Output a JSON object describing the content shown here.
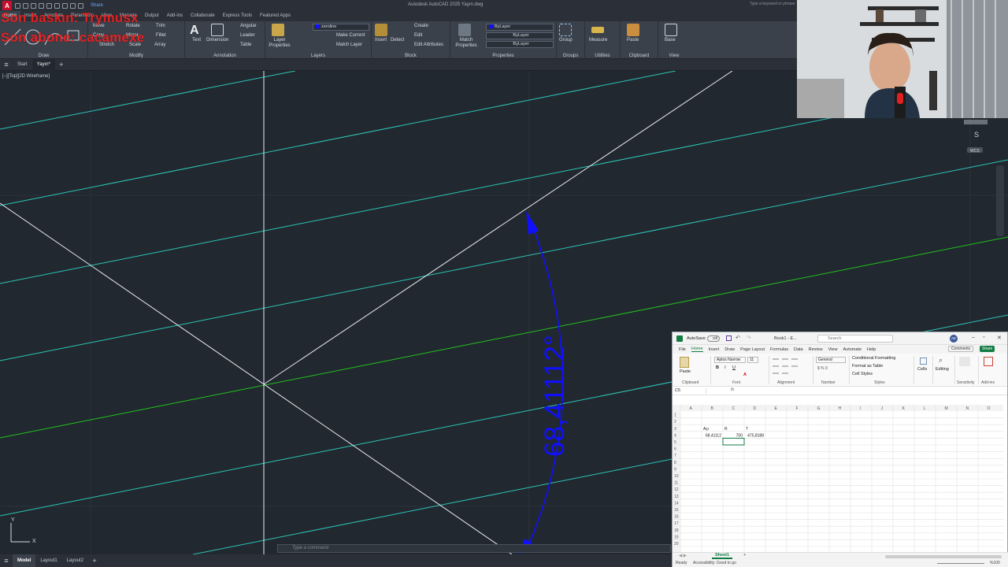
{
  "autocad": {
    "app_title": "Autodesk AutoCAD 2025 Yayın.dwg",
    "keyword_search": "Type a keyword or phrase",
    "share_label": "Share",
    "ribbon_tabs": [
      "Home",
      "Insert",
      "Annotate",
      "Parametric",
      "View",
      "Manage",
      "Output",
      "Add-ins",
      "Collaborate",
      "Express Tools",
      "Featured Apps"
    ],
    "modify_items": [
      "Move",
      "Rotate",
      "Trim",
      "Copy",
      "Mirror",
      "Fillet",
      "Stretch",
      "Scale",
      "Array"
    ],
    "annotation_items": [
      "Text",
      "Dimension",
      "Angular",
      "Leader",
      "Table"
    ],
    "layers_items": [
      "Layer Properties",
      "Make Current",
      "Match Layer"
    ],
    "layer_combo": "zeroline",
    "block_items": [
      "Insert",
      "Create",
      "Edit",
      "Edit Attributes",
      "Detect"
    ],
    "properties_items": [
      "Match Properties"
    ],
    "property_combos": [
      "ByLayer",
      "ByLayer",
      "ByLayer"
    ],
    "groups_items": [
      "Group"
    ],
    "utilities_items": [
      "Measure"
    ],
    "clipboard_items": [
      "Paste"
    ],
    "view_items": [
      "Base"
    ],
    "panel_titles": [
      "Draw",
      "Modify",
      "Annotation",
      "Layers",
      "Block",
      "Properties",
      "Groups",
      "Utilities",
      "Clipboard",
      "View"
    ],
    "file_tabs": [
      "Start",
      "Yayın*"
    ],
    "viewport_label": "[–][Top][2D Wireframe]",
    "dimension_text": "68,41112°",
    "command_placeholder": "Type a command",
    "layout_tabs": [
      "Model",
      "Layout1",
      "Layout2"
    ],
    "viewcube_dir": "S",
    "wcs_label": "WCS",
    "ucs_y": "Y",
    "ucs_x": "X"
  },
  "overlay": {
    "line1": "Son baskın: Trymusx",
    "line2": "Son abone: cacamexe"
  },
  "excel": {
    "autosave_label": "AutoSave",
    "autosave_state": "Off",
    "book_title": "Book1 - E...",
    "search_placeholder": "Search",
    "avatar_initials": "AE",
    "menu": [
      "File",
      "Home",
      "Insert",
      "Draw",
      "Page Layout",
      "Formulas",
      "Data",
      "Review",
      "View",
      "Automate",
      "Help"
    ],
    "comments_label": "Comments",
    "share_label": "Share",
    "font_name": "Aptos Narrow",
    "font_size": "11",
    "number_format": "General",
    "styles_items": [
      "Conditional Formatting",
      "Format as Table",
      "Cell Styles"
    ],
    "ribbon_groups": [
      "Clipboard",
      "Font",
      "Alignment",
      "Number",
      "Styles",
      "Cells",
      "Editing",
      "Sensitivity",
      "Add-ins"
    ],
    "ribbon_buttons": [
      "Paste",
      "Cells",
      "Editing"
    ],
    "name_box": "C5",
    "fx": "fx",
    "columns": [
      "A",
      "B",
      "C",
      "D",
      "E",
      "F",
      "G",
      "H",
      "I",
      "J",
      "K",
      "L",
      "M",
      "N",
      "O"
    ],
    "rows": [
      "1",
      "2",
      "3",
      "4",
      "5",
      "6",
      "7",
      "8",
      "9",
      "10",
      "11",
      "12",
      "13",
      "14",
      "15",
      "16",
      "17",
      "18",
      "19",
      "20"
    ],
    "cells": {
      "B3": "Açı",
      "C3": "R",
      "D3": "T",
      "B4": "68,41112",
      "C4": "700",
      "D4": "475,8188"
    },
    "sheet_tab": "Sheet1",
    "status_ready": "Ready",
    "status_accessibility": "Accessibility: Good to go",
    "zoom": "%100"
  },
  "colors": {
    "drawing_bg": "#212830",
    "cyan_lines": "#2ec4b6",
    "green_line": "#22c31a",
    "white_lines": "#e8ecef",
    "dimension_blue": "#1010ff",
    "excel_green": "#107c41"
  }
}
